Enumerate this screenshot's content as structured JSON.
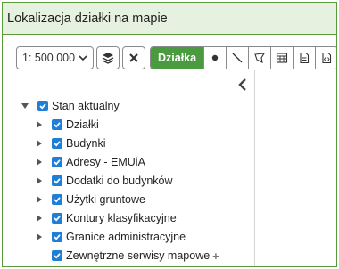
{
  "window": {
    "title": "Lokalizacja działki na mapie"
  },
  "toolbar": {
    "scale_value": "1: 500 000",
    "active_tool_label": "Działka",
    "icons": [
      "chevron-down-icon",
      "layers-icon",
      "close-icon",
      "point-icon",
      "line-icon",
      "polygon-icon",
      "table-icon",
      "document-icon",
      "code-icon"
    ]
  },
  "layers": {
    "root": {
      "label": "Stan aktualny",
      "checked": true,
      "expanded": true
    },
    "items": [
      {
        "label": "Działki",
        "checked": true
      },
      {
        "label": "Budynki",
        "checked": true
      },
      {
        "label": "Adresy - EMUiA",
        "checked": true
      },
      {
        "label": "Dodatki do budynków",
        "checked": true
      },
      {
        "label": "Użytki gruntowe",
        "checked": true
      },
      {
        "label": "Kontury klasyfikacyjne",
        "checked": true
      },
      {
        "label": "Granice administracyjne",
        "checked": true
      }
    ],
    "external": {
      "label": "Zewnętrzne serwisy mapowe",
      "checked": true,
      "add_symbol": "+"
    }
  },
  "colors": {
    "accent_green": "#4a9a3f",
    "checkbox_blue": "#1f7fd6",
    "title_bg": "#e7f1df"
  }
}
